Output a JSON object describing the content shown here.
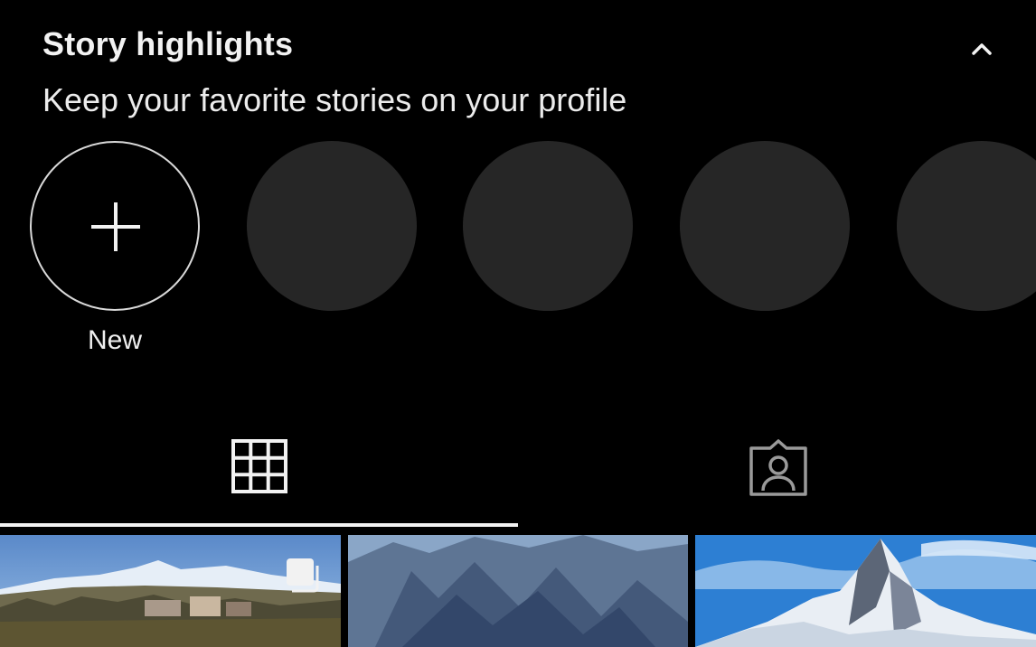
{
  "highlights": {
    "title": "Story highlights",
    "subtitle": "Keep your favorite stories on your profile",
    "collapse_icon": "chevron-up-icon",
    "new_label": "New",
    "new_icon": "plus-icon",
    "placeholder_count": 4,
    "placeholder_color": "#262626"
  },
  "tabs": [
    {
      "icon": "grid-icon",
      "selected": true
    },
    {
      "icon": "tagged-person-icon",
      "selected": false
    }
  ],
  "posts": [
    {
      "image": "snowy-mountain-village-photo",
      "badge": "multiple-photos-icon"
    },
    {
      "image": "rocky-mountain-face-photo"
    },
    {
      "image": "matterhorn-peak-photo"
    }
  ],
  "colors": {
    "background": "#000000",
    "text": "#f2f2f2",
    "indicator": "#f2f2f2"
  }
}
